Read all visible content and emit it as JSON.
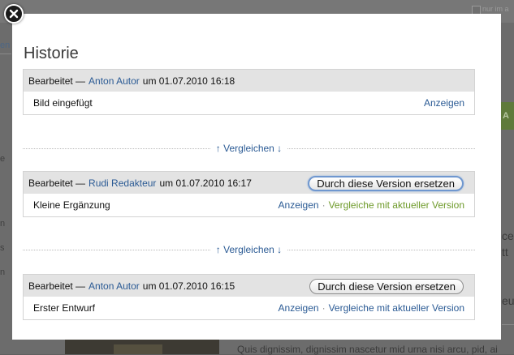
{
  "background": {
    "checkbox_label": "nur im a",
    "left_link": "en",
    "left_texts": [
      "e",
      "n",
      "s",
      "n"
    ],
    "green_button": "A",
    "right_texts": [
      "ce",
      "tt",
      "eu"
    ],
    "bottom_text": "Quis dignissim, dignissim nascetur mid urna nisi arcu, pid, ai"
  },
  "dialog": {
    "title": "Historie",
    "close_icon": "close-icon",
    "compare_label": "↑ Vergleichen ↓",
    "entries": [
      {
        "prefix": "Bearbeitet —",
        "author": "Anton Autor",
        "date_text": "um 01.07.2010 16:18",
        "comment": "Bild eingefügt",
        "view_label": "Anzeigen",
        "replace_label": "",
        "compare_current_label": ""
      },
      {
        "prefix": "Bearbeitet —",
        "author": "Rudi Redakteur",
        "date_text": "um 01.07.2010 16:17",
        "comment": "Kleine Ergänzung",
        "view_label": "Anzeigen",
        "replace_label": "Durch diese Version ersetzen",
        "compare_current_label": "Vergleiche mit aktueller Version"
      },
      {
        "prefix": "Bearbeitet —",
        "author": "Anton Autor",
        "date_text": "um 01.07.2010 16:15",
        "comment": "Erster Entwurf",
        "view_label": "Anzeigen",
        "replace_label": "Durch diese Version ersetzen",
        "compare_current_label": "Vergleiche mit aktueller Version"
      }
    ],
    "separator": "·"
  },
  "colors": {
    "link": "#2a5a94",
    "compare_current": "#6e9a2a",
    "header_bg": "#e3e3e3"
  }
}
